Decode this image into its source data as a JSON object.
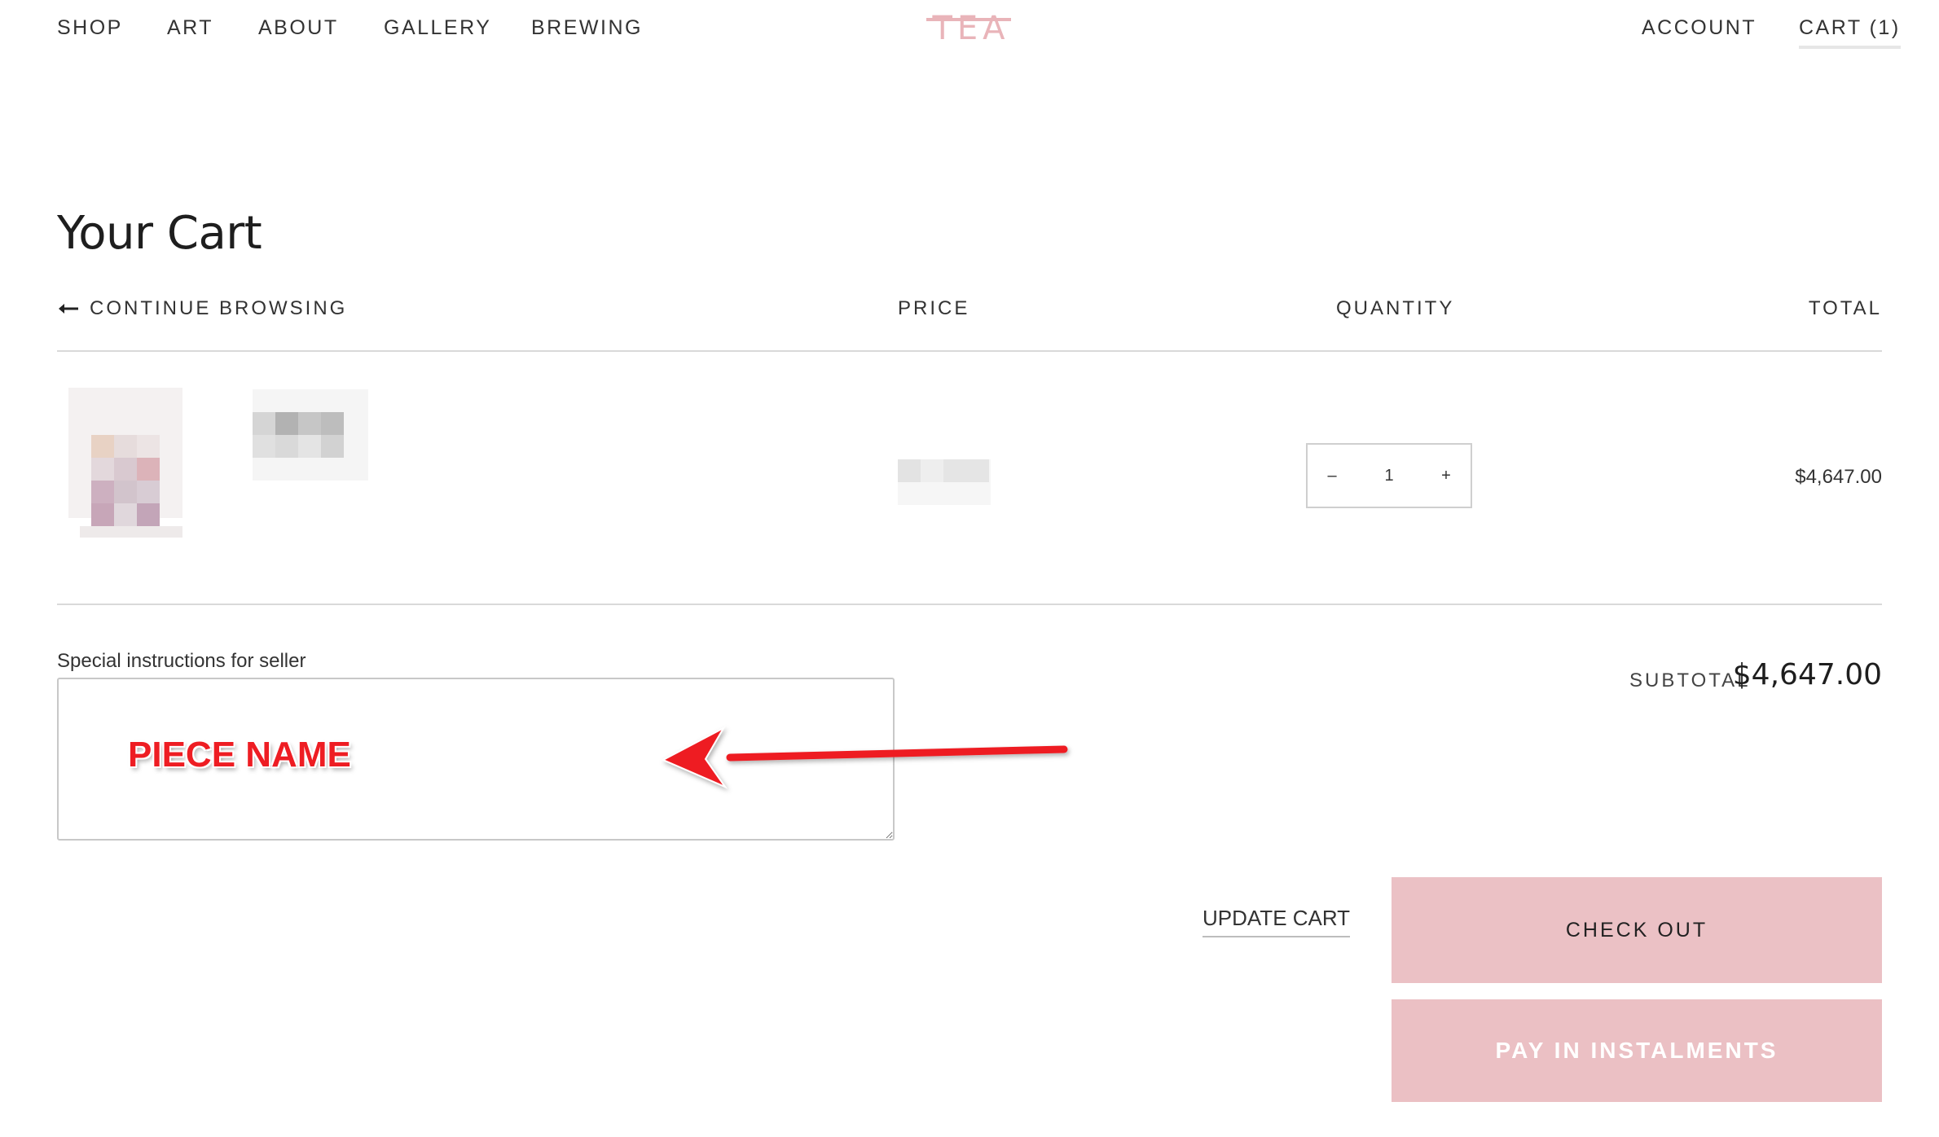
{
  "nav": {
    "left": [
      {
        "label": "SHOP"
      },
      {
        "label": "ART"
      },
      {
        "label": "ABOUT"
      },
      {
        "label": "GALLERY"
      },
      {
        "label": "BREWING"
      }
    ],
    "logo": "TEA",
    "account": "ACCOUNT",
    "cart": "CART (1)"
  },
  "page": {
    "title": "Your Cart"
  },
  "table": {
    "continue_label": "CONTINUE BROWSING",
    "price_header": "PRICE",
    "quantity_header": "QUANTITY",
    "total_header": "TOTAL"
  },
  "item": {
    "image_icon": "blurred-product-image",
    "name": "",
    "price": "",
    "quantity": "1",
    "decrement_label": "–",
    "increment_label": "+",
    "line_total": "$4,647.00"
  },
  "instructions": {
    "label": "Special instructions for seller",
    "value": ""
  },
  "annotation": {
    "text": "PIECE NAME",
    "color": "#ee1d23"
  },
  "summary": {
    "subtotal_label": "SUBTOTAL",
    "subtotal_value": "$4,647.00",
    "update_cart": "UPDATE CART",
    "checkout": "CHECK OUT",
    "pay_instalments": "PAY IN INSTALMENTS"
  },
  "colors": {
    "accent_pink": "#ebc1c5",
    "logo_pink": "#e9b4b9"
  }
}
